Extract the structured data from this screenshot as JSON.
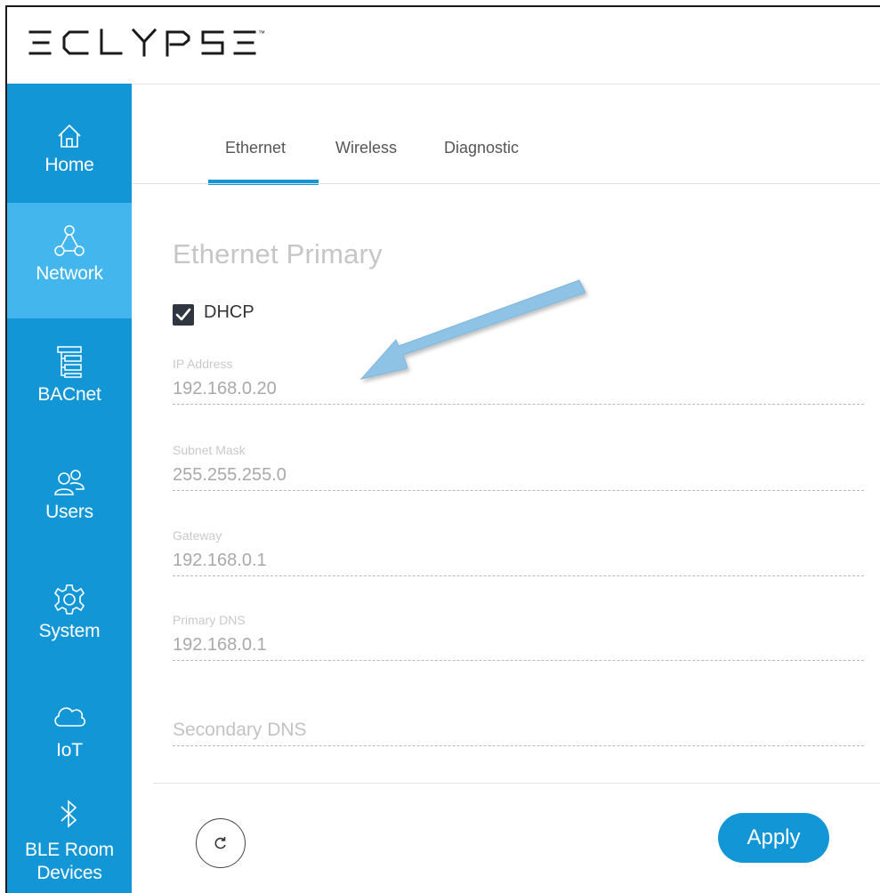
{
  "brand": {
    "logo_text": "ECLYPSE",
    "trademark": "™"
  },
  "sidebar": {
    "items": [
      {
        "label": "Home",
        "icon": "home-icon",
        "active": false
      },
      {
        "label": "Network",
        "icon": "network-icon",
        "active": true
      },
      {
        "label": "BACnet",
        "icon": "bacnet-icon",
        "active": false
      },
      {
        "label": "Users",
        "icon": "users-icon",
        "active": false
      },
      {
        "label": "System",
        "icon": "gear-icon",
        "active": false
      },
      {
        "label": "IoT",
        "icon": "cloud-icon",
        "active": false
      },
      {
        "label": "BLE Room Devices",
        "label_line1": "BLE Room",
        "label_line2": "Devices",
        "icon": "bluetooth-icon",
        "active": false
      }
    ]
  },
  "tabs": [
    {
      "label": "Ethernet",
      "active": true
    },
    {
      "label": "Wireless",
      "active": false
    },
    {
      "label": "Diagnostic",
      "active": false
    }
  ],
  "section": {
    "title": "Ethernet Primary",
    "dhcp": {
      "label": "DHCP",
      "checked": true
    }
  },
  "fields": {
    "ip": {
      "label": "IP Address",
      "value": "192.168.0.20"
    },
    "subnet": {
      "label": "Subnet Mask",
      "value": "255.255.255.0"
    },
    "gateway": {
      "label": "Gateway",
      "value": "192.168.0.1"
    },
    "primary_dns": {
      "label": "Primary DNS",
      "value": "192.168.0.1"
    },
    "secondary_dns": {
      "placeholder": "Secondary DNS",
      "value": ""
    }
  },
  "footer": {
    "apply_label": "Apply",
    "refresh_icon": "refresh-icon"
  },
  "colors": {
    "sidebar": "#1396d6",
    "sidebar_active": "#43b7ed",
    "accent": "#1396d6",
    "annotation_arrow": "#8ec3e6"
  }
}
